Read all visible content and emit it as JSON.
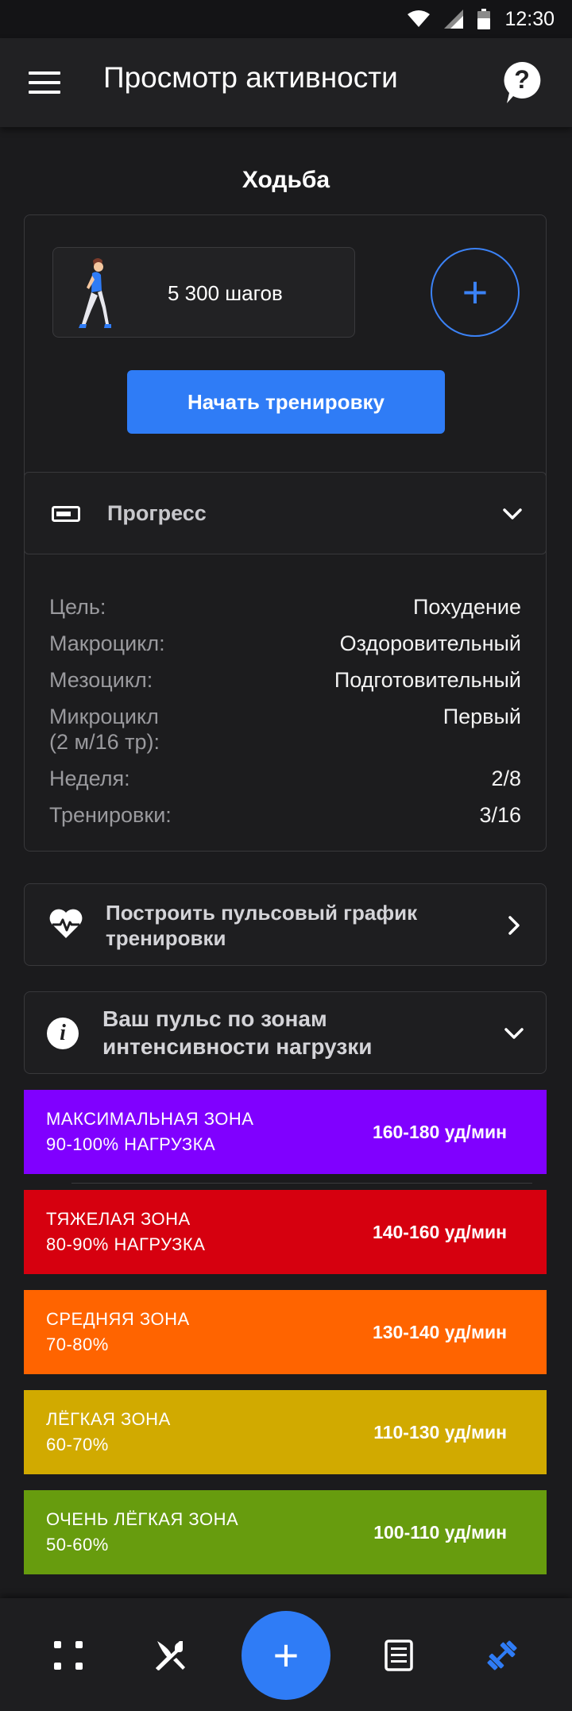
{
  "status_bar": {
    "time": "12:30"
  },
  "header": {
    "title": "Просмотр активности"
  },
  "activity": {
    "title": "Ходьба",
    "steps": "5 300 шагов",
    "start_label": "Начать тренировку",
    "add_symbol": "+"
  },
  "progress": {
    "label": "Прогресс",
    "rows": [
      {
        "label": "Цель:",
        "value": "Похудение"
      },
      {
        "label": "Макроцикл:",
        "value": "Оздоровительный"
      },
      {
        "label": "Мезоцикл:",
        "value": "Подготовительный"
      },
      {
        "label": "Микроцикл\n (2 м/16 тр):",
        "value": "Первый"
      },
      {
        "label": "Неделя:",
        "value": "2/8"
      },
      {
        "label": "Тренировки:",
        "value": "3/16"
      }
    ]
  },
  "pulse_graph": {
    "label": "Построить пульсовый график тренировки"
  },
  "zones": {
    "label": "Ваш пульс по зонам интенсивности нагрузки",
    "items": [
      {
        "name": "МАКСИМАЛЬНАЯ ЗОНА",
        "load": "90-100% НАГРУЗКА",
        "bpm": "160-180 уд/мин",
        "color": "#8000ff"
      },
      {
        "name": "ТЯЖЕЛАЯ ЗОНА",
        "load": "80-90% НАГРУЗКА",
        "bpm": "140-160 уд/мин",
        "color": "#d6000f"
      },
      {
        "name": "СРЕДНЯЯ ЗОНА",
        "load": "70-80%",
        "bpm": "130-140 уд/мин",
        "color": "#ff6400"
      },
      {
        "name": "ЛЁГКАЯ ЗОНА",
        "load": "60-70%",
        "bpm": "110-130 уд/мин",
        "color": "#d1aa00"
      },
      {
        "name": "ОЧЕНЬ ЛЁГКАЯ ЗОНА",
        "load": "50-60%",
        "bpm": "100-110 уд/мин",
        "color": "#679c0e"
      }
    ]
  },
  "bottom_nav": {
    "items": [
      "dashboard-icon",
      "food-icon",
      "add-icon",
      "notes-icon",
      "workout-icon"
    ],
    "active": "workout-icon",
    "fab_symbol": "+",
    "accent": "#2f7cf6"
  }
}
